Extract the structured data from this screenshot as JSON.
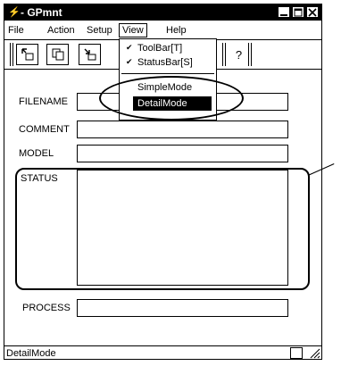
{
  "window": {
    "app_icon": "lightning-icon",
    "title": "- GPmnt",
    "controls": [
      "minimize-icon",
      "maximize-icon",
      "close-icon"
    ]
  },
  "menubar": {
    "file": "File",
    "action": "Action",
    "setup": "Setup",
    "view": "View",
    "help": "Help"
  },
  "toolbar": {
    "buttons": [
      "toolbar-button-1",
      "toolbar-button-2",
      "toolbar-button-3",
      "toolbar-button-4"
    ],
    "help_glyph": "?"
  },
  "view_menu": {
    "items": [
      {
        "label": "ToolBar[T]",
        "checked": true
      },
      {
        "label": "StatusBar[S]",
        "checked": true
      },
      {
        "label": "SimpleMode",
        "checked": false
      },
      {
        "label": "DetailMode",
        "checked": false,
        "highlighted": true
      }
    ],
    "check_glyph": "✔"
  },
  "form": {
    "filename_label": "FILENAME",
    "comment_label": "COMMENT",
    "model_label": "MODEL",
    "status_label": "STATUS",
    "process_label": "PROCESS"
  },
  "statusbar": {
    "text": "DetailMode"
  }
}
